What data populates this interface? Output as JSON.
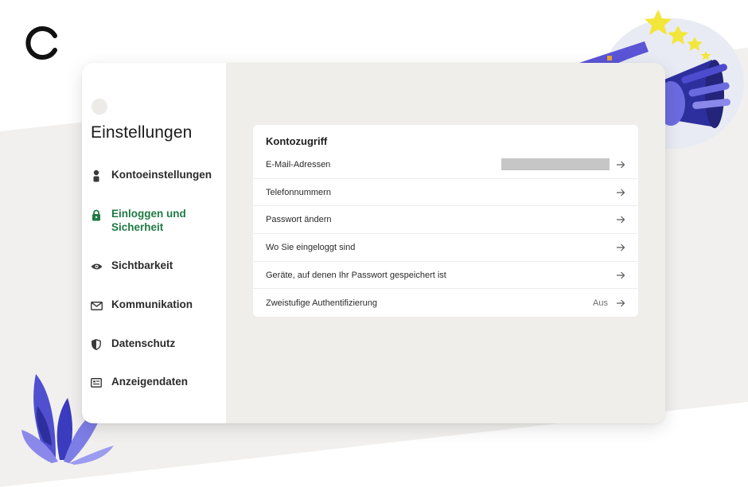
{
  "colors": {
    "accent_green": "#1f7a45",
    "background_band": "#f1f0ee",
    "panel": "#efeeea",
    "illustration_purple": "#6b6be0",
    "illustration_navy": "#2e2f9e",
    "stars": "#f3e63a"
  },
  "logo": {
    "icon": "brand-ring-icon"
  },
  "sidebar": {
    "title": "Einstellungen",
    "items": [
      {
        "label": "Kontoeinstellungen",
        "icon": "person-icon",
        "active": false
      },
      {
        "label": "Einloggen und Sicherheit",
        "icon": "lock-icon",
        "active": true
      },
      {
        "label": "Sichtbarkeit",
        "icon": "eye-icon",
        "active": false
      },
      {
        "label": "Kommunikation",
        "icon": "mail-icon",
        "active": false
      },
      {
        "label": "Datenschutz",
        "icon": "shield-icon",
        "active": false
      },
      {
        "label": "Anzeigendaten",
        "icon": "ad-data-icon",
        "active": false
      }
    ]
  },
  "card": {
    "title": "Kontozugriff",
    "rows": [
      {
        "label": "E-Mail-Adressen",
        "value": "",
        "redacted": true
      },
      {
        "label": "Telefonnummern",
        "value": ""
      },
      {
        "label": "Passwort ändern",
        "value": ""
      },
      {
        "label": "Wo Sie eingeloggt sind",
        "value": ""
      },
      {
        "label": "Geräte, auf denen Ihr Passwort gespeichert ist",
        "value": ""
      },
      {
        "label": "Zweistufige Authentifizierung",
        "value": "Aus"
      }
    ]
  }
}
